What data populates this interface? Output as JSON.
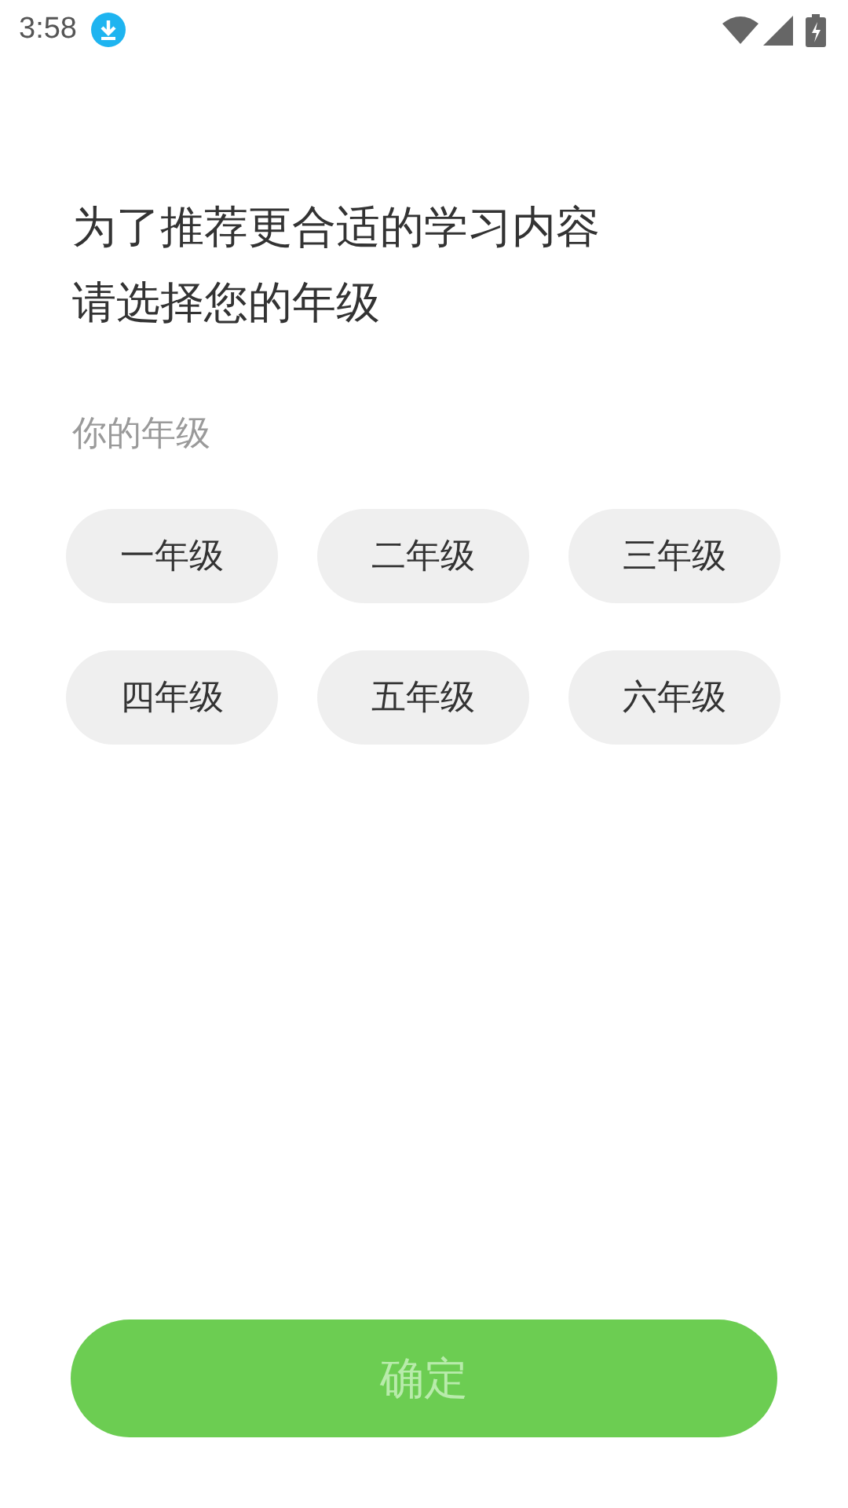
{
  "status_bar": {
    "time": "3:58"
  },
  "heading": [
    "为了推荐更合适的学习内容",
    "请选择您的年级"
  ],
  "section_label": "你的年级",
  "grades": [
    {
      "label": "一年级",
      "selected": false
    },
    {
      "label": "二年级",
      "selected": false
    },
    {
      "label": "三年级",
      "selected": false
    },
    {
      "label": "四年级",
      "selected": false
    },
    {
      "label": "五年级",
      "selected": false
    },
    {
      "label": "六年级",
      "selected": false
    }
  ],
  "confirm_button": {
    "label": "确定",
    "disabled": true
  }
}
